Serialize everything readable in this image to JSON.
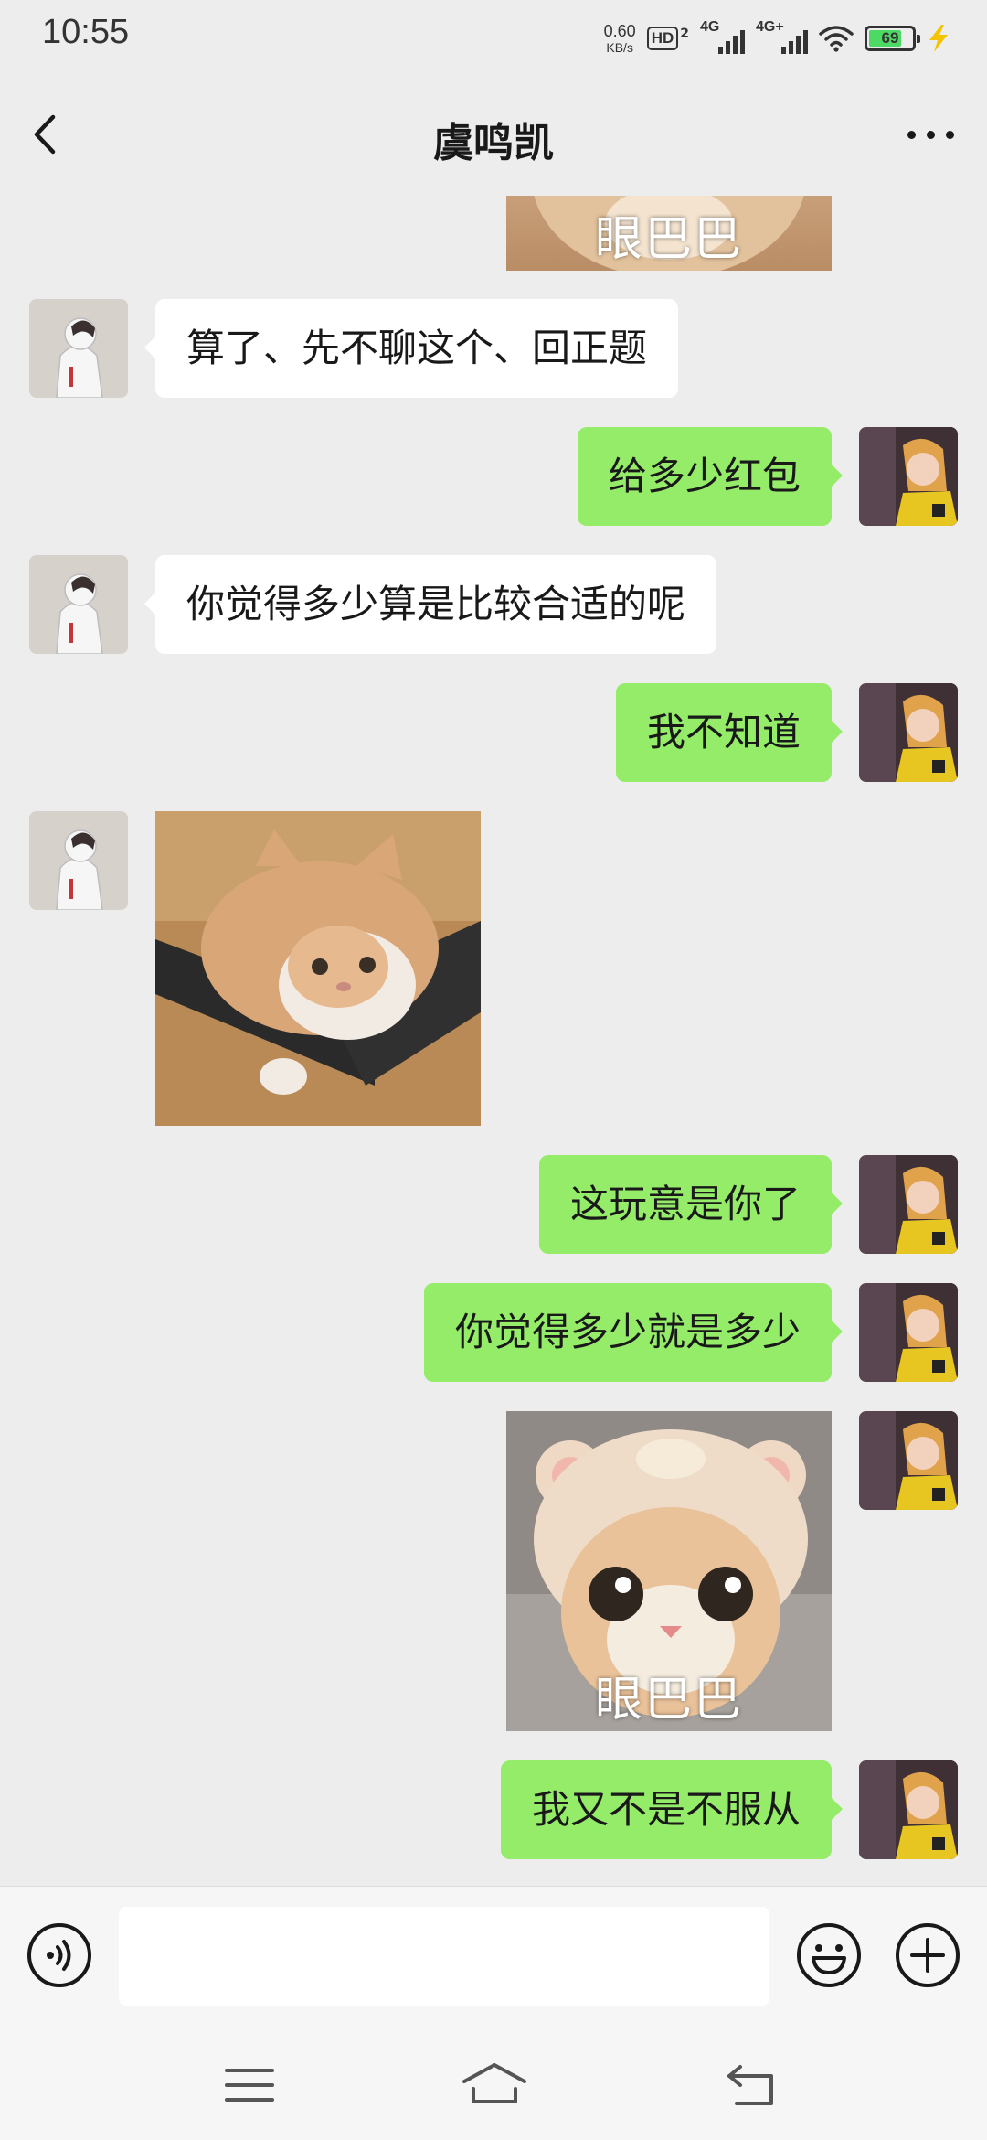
{
  "status_bar": {
    "time": "10:55",
    "net_speed_value": "0.60",
    "net_speed_unit": "KB/s",
    "hd_label": "HD",
    "hd_sub": "2",
    "sim1_label": "4G",
    "sim2_label": "4G+",
    "battery_percent": "69",
    "battery_level": 0.69,
    "charging": true
  },
  "header": {
    "title": "虞鸣凯",
    "back_icon": "chevron-left-icon",
    "more_icon": "more-dots-icon"
  },
  "messages": [
    {
      "side": "out",
      "type": "sticker",
      "caption": "眼巴巴"
    },
    {
      "side": "in",
      "type": "text",
      "text": "算了、先不聊这个、回正题"
    },
    {
      "side": "out",
      "type": "text",
      "text": "给多少红包"
    },
    {
      "side": "in",
      "type": "text",
      "text": "你觉得多少算是比较合适的呢"
    },
    {
      "side": "out",
      "type": "text",
      "text": "我不知道"
    },
    {
      "side": "in",
      "type": "sticker",
      "caption": ""
    },
    {
      "side": "out",
      "type": "text",
      "text": "这玩意是你了"
    },
    {
      "side": "out",
      "type": "text",
      "text": "你觉得多少就是多少"
    },
    {
      "side": "out",
      "type": "sticker",
      "caption": "眼巴巴"
    },
    {
      "side": "out",
      "type": "text",
      "text": "我又不是不服从"
    }
  ],
  "input_bar": {
    "voice_icon": "voice-icon",
    "input_value": "",
    "emoji_icon": "emoji-icon",
    "plus_icon": "plus-icon"
  },
  "system_nav": {
    "menu_icon": "menu-icon",
    "home_icon": "home-icon",
    "back_icon": "back-icon"
  },
  "colors": {
    "background": "#ededed",
    "outgoing_bubble": "#95ec69",
    "incoming_bubble": "#ffffff",
    "battery_fill": "#4cd964",
    "charge_bolt": "#f5c400"
  }
}
